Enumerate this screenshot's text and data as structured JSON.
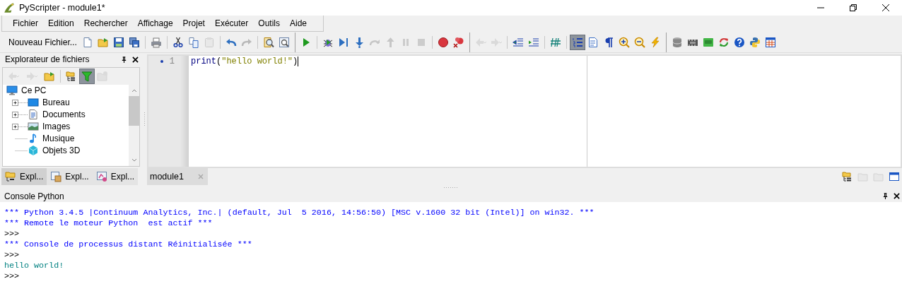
{
  "window": {
    "title": "PyScripter - module1*"
  },
  "menu": [
    "Fichier",
    "Edition",
    "Rechercher",
    "Affichage",
    "Projet",
    "Exécuter",
    "Outils",
    "Aide"
  ],
  "toolbar": {
    "new_file_label": "Nouveau Fichier...",
    "buttons": [
      {
        "disabled": false,
        "selected": false
      },
      {
        "disabled": false,
        "selected": false
      },
      {
        "disabled": false,
        "selected": false
      },
      {
        "disabled": false,
        "selected": false
      },
      {
        "disabled": false,
        "selected": false
      },
      {
        "disabled": false,
        "selected": false
      },
      {
        "disabled": false,
        "selected": false
      },
      {
        "disabled": true,
        "selected": false
      },
      {
        "disabled": false,
        "selected": false
      },
      {
        "disabled": true,
        "selected": false
      },
      {
        "disabled": false,
        "selected": false
      },
      {
        "disabled": false,
        "selected": false
      },
      {
        "disabled": false,
        "selected": false
      },
      {
        "disabled": false,
        "selected": false
      },
      {
        "disabled": false,
        "selected": false
      },
      {
        "disabled": false,
        "selected": false
      },
      {
        "disabled": true,
        "selected": false
      },
      {
        "disabled": true,
        "selected": false
      },
      {
        "disabled": true,
        "selected": false
      },
      {
        "disabled": true,
        "selected": false
      },
      {
        "disabled": false,
        "selected": false
      },
      {
        "disabled": false,
        "selected": false
      },
      {
        "disabled": true,
        "selected": false
      },
      {
        "disabled": true,
        "selected": false
      },
      {
        "disabled": false,
        "selected": false
      },
      {
        "disabled": false,
        "selected": false
      },
      {
        "disabled": false,
        "selected": false
      },
      {
        "disabled": false,
        "selected": true
      },
      {
        "disabled": false,
        "selected": false
      },
      {
        "disabled": false,
        "selected": false
      },
      {
        "disabled": false,
        "selected": false
      },
      {
        "disabled": false,
        "selected": false
      },
      {
        "disabled": false,
        "selected": false
      },
      {
        "disabled": false,
        "selected": false
      },
      {
        "disabled": false,
        "selected": false
      },
      {
        "disabled": false,
        "selected": false
      },
      {
        "disabled": false,
        "selected": false
      },
      {
        "disabled": false,
        "selected": false
      },
      {
        "disabled": false,
        "selected": false
      },
      {
        "disabled": false,
        "selected": false
      }
    ]
  },
  "file_explorer": {
    "title": "Explorateur de fichiers",
    "toolbar": [
      {
        "disabled": true,
        "selected": false
      },
      {
        "disabled": true,
        "selected": false
      },
      {
        "disabled": false,
        "selected": false
      },
      {
        "disabled": false,
        "selected": false
      },
      {
        "disabled": false,
        "selected": true
      },
      {
        "disabled": true,
        "selected": false
      }
    ],
    "tree": [
      {
        "label": "Ce PC",
        "children": [
          {
            "label": "Bureau",
            "expandable": true,
            "expanded": false
          },
          {
            "label": "Documents",
            "expandable": true,
            "expanded": false
          },
          {
            "label": "Images",
            "expandable": true,
            "expanded": false
          },
          {
            "label": "Musique",
            "expandable": false
          },
          {
            "label": "Objets 3D",
            "expandable": false
          }
        ]
      }
    ],
    "tabs": [
      {
        "label": "Expl...",
        "selected": true
      },
      {
        "label": "Expl...",
        "selected": false
      },
      {
        "label": "Expl...",
        "selected": false
      }
    ]
  },
  "editor": {
    "tabs": [
      {
        "label": "module1",
        "selected": true
      }
    ],
    "lines": [
      {
        "number": "1",
        "tokens": [
          {
            "kind": "builtin",
            "text": "print"
          },
          {
            "kind": "punct",
            "text": "("
          },
          {
            "kind": "string",
            "text": "\"hello world!\""
          },
          {
            "kind": "punct",
            "text": ")"
          }
        ]
      }
    ],
    "tab_tools": [
      {
        "disabled": false
      },
      {
        "disabled": true
      },
      {
        "disabled": true
      },
      {
        "disabled": false
      }
    ]
  },
  "console": {
    "title": "Console Python",
    "lines": [
      {
        "kind": "info",
        "text": "*** Python 3.4.5 |Continuum Analytics, Inc.| (default, Jul  5 2016, 14:56:50) [MSC v.1600 32 bit (Intel)] on win32. ***"
      },
      {
        "kind": "info",
        "text": "*** Remote le moteur Python  est actif ***"
      },
      {
        "kind": "prompt",
        "text": ">>>"
      },
      {
        "kind": "info",
        "text": "*** Console de processus distant Réinitialisée ***"
      },
      {
        "kind": "prompt",
        "text": ">>>"
      },
      {
        "kind": "output",
        "text": "hello world!"
      },
      {
        "kind": "prompt",
        "text": ">>>"
      }
    ]
  }
}
